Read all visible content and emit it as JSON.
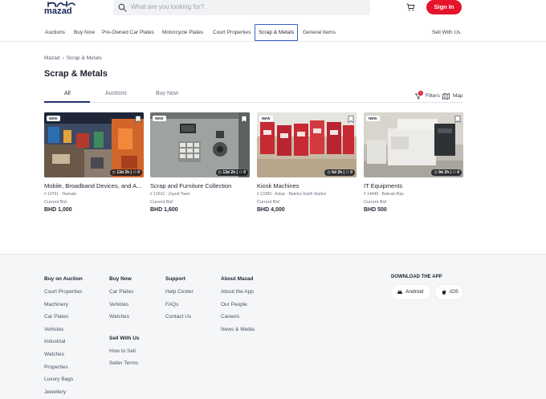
{
  "header": {
    "logo_text": "mazad",
    "search_placeholder": "What are you looking for?",
    "signin_label": "Sign In"
  },
  "nav": {
    "categories": [
      "Auctions",
      "Buy Now",
      "Pre-Owned Car Plates",
      "Motorcycle Plates",
      "Court Properties",
      "Scrap & Metals",
      "General Items"
    ],
    "active": "Scrap & Metals",
    "sell_label": "Sell With Us"
  },
  "breadcrumb": [
    "Mazad",
    "›",
    "Scrap & Metals"
  ],
  "page_title": "Scrap & Metals",
  "tabs": [
    "All",
    "Auctions",
    "Buy Now"
  ],
  "tools": {
    "filters_label": "Filters",
    "filters_count": "1",
    "map_label": "Map"
  },
  "listings": [
    {
      "badge": "NEW",
      "time": "13d 2h",
      "bids": "0",
      "title": "Mobile, Broadband Devices, and A...",
      "meta": "# 10761 · Hamala",
      "bid_label": "Current Bid",
      "price": "BHD 1,000"
    },
    {
      "badge": "NEW",
      "time": "13d 2h",
      "bids": "0",
      "title": "Scrap and Furniture Collection",
      "meta": "# 13512 · Zayed Town",
      "bid_label": "Current Bid",
      "price": "BHD 1,600"
    },
    {
      "badge": "NEW",
      "time": "6d 2h",
      "bids": "0",
      "title": "Kiosk Machines",
      "meta": "# 13383 · Askar · Batelco Earth Station",
      "bid_label": "Current Bid",
      "price": "BHD 4,000"
    },
    {
      "badge": "NEW",
      "time": "9d 2h",
      "bids": "0",
      "title": "IT Equipments",
      "meta": "# 14449 · Bahrain Bay",
      "bid_label": "Current Bid",
      "price": "BHD 500"
    }
  ],
  "footer": {
    "col1": {
      "title": "Buy on Auction",
      "links": [
        "Court Properties",
        "Machinery",
        "Car Plates",
        "Vehicles",
        "Industrial",
        "Watches",
        "Properties",
        "Luxury Bags",
        "Jewellery"
      ]
    },
    "col2": {
      "title": "Buy Now",
      "links": [
        "Car Plates",
        "Vehicles",
        "Watches"
      ],
      "title2": "Sell With Us",
      "links2": [
        "How to Sell",
        "Seller Terms"
      ]
    },
    "col3": {
      "title": "Support",
      "links": [
        "Help Center",
        "FAQs",
        "Contact Us"
      ]
    },
    "col4": {
      "title": "About Mazad",
      "links": [
        "About the App",
        "Our People",
        "Careers",
        "News & Media"
      ]
    },
    "app": {
      "title": "DOWNLOAD THE APP",
      "android": "Android",
      "ios": "iOS"
    }
  },
  "colors": {
    "brand_red": "#e5142b",
    "brand_navy": "#14245a",
    "active_border": "#3a5cc7"
  }
}
